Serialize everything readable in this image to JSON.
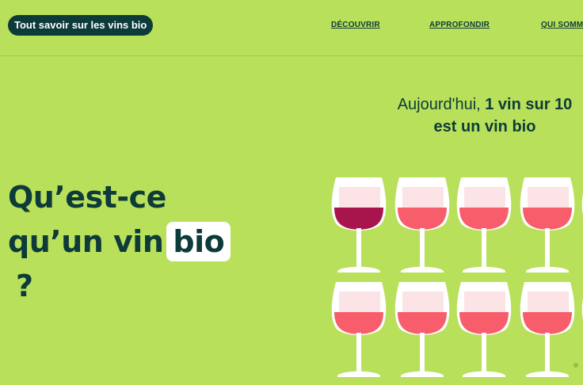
{
  "header": {
    "site_title": "Tout savoir sur les vins bio",
    "nav": [
      {
        "label": "DÉCOUVRIR"
      },
      {
        "label": "APPROFONDIR"
      },
      {
        "label": "QUI SOMMES"
      }
    ]
  },
  "hero": {
    "headline_line1": "Qu’est-ce",
    "headline_line2_prefix": "qu’un vin",
    "headline_highlight": "bio",
    "headline_question": "?",
    "stat_prefix": "Aujourd'hui,",
    "stat_emphasis": "1 vin sur 10",
    "stat_suffix": "est un vin bio"
  },
  "infographic": {
    "rows": 2,
    "glass_count": 10,
    "highlighted_count": 1,
    "colors": {
      "highlight_wine": "#a8154c",
      "regular_wine": "#f85d6b",
      "glass": "#ffffff",
      "glass_tint": "#fbe3e6"
    }
  },
  "colors": {
    "background": "#b8e05a",
    "primary": "#0d3b3a"
  }
}
